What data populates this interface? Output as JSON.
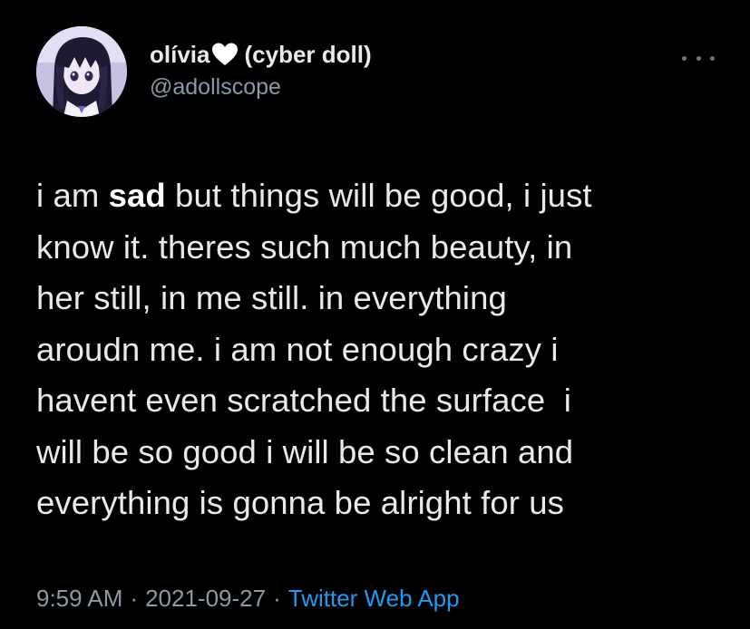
{
  "tweet": {
    "author": {
      "display_name": "olívia",
      "name_emoji": "white-heart-icon",
      "name_suffix": "(cyber doll)",
      "handle": "@adollscope",
      "avatar": "avatar-anime-girl-image"
    },
    "more_icon": "more-horizontal-icon",
    "text_lines": [
      {
        "before": "i am ",
        "bold": "sad",
        "after": " but things will be good, i just"
      },
      {
        "text": "know it. theres such much beauty, in"
      },
      {
        "text": "her still, in me still. in everything"
      },
      {
        "text": "aroudn me. i am not enough crazy i"
      },
      {
        "text": "havent even scratched the surface  i"
      },
      {
        "text": "will be so good i will be so clean and"
      },
      {
        "text": "everything is gonna be alright for us"
      }
    ],
    "time": "9:59 AM",
    "separator": "·",
    "date": "2021-09-27",
    "source": "Twitter Web App"
  },
  "colors": {
    "background": "#000000",
    "text": "#e7e9ea",
    "secondary": "#8b98a5",
    "link": "#1d9bf0"
  }
}
